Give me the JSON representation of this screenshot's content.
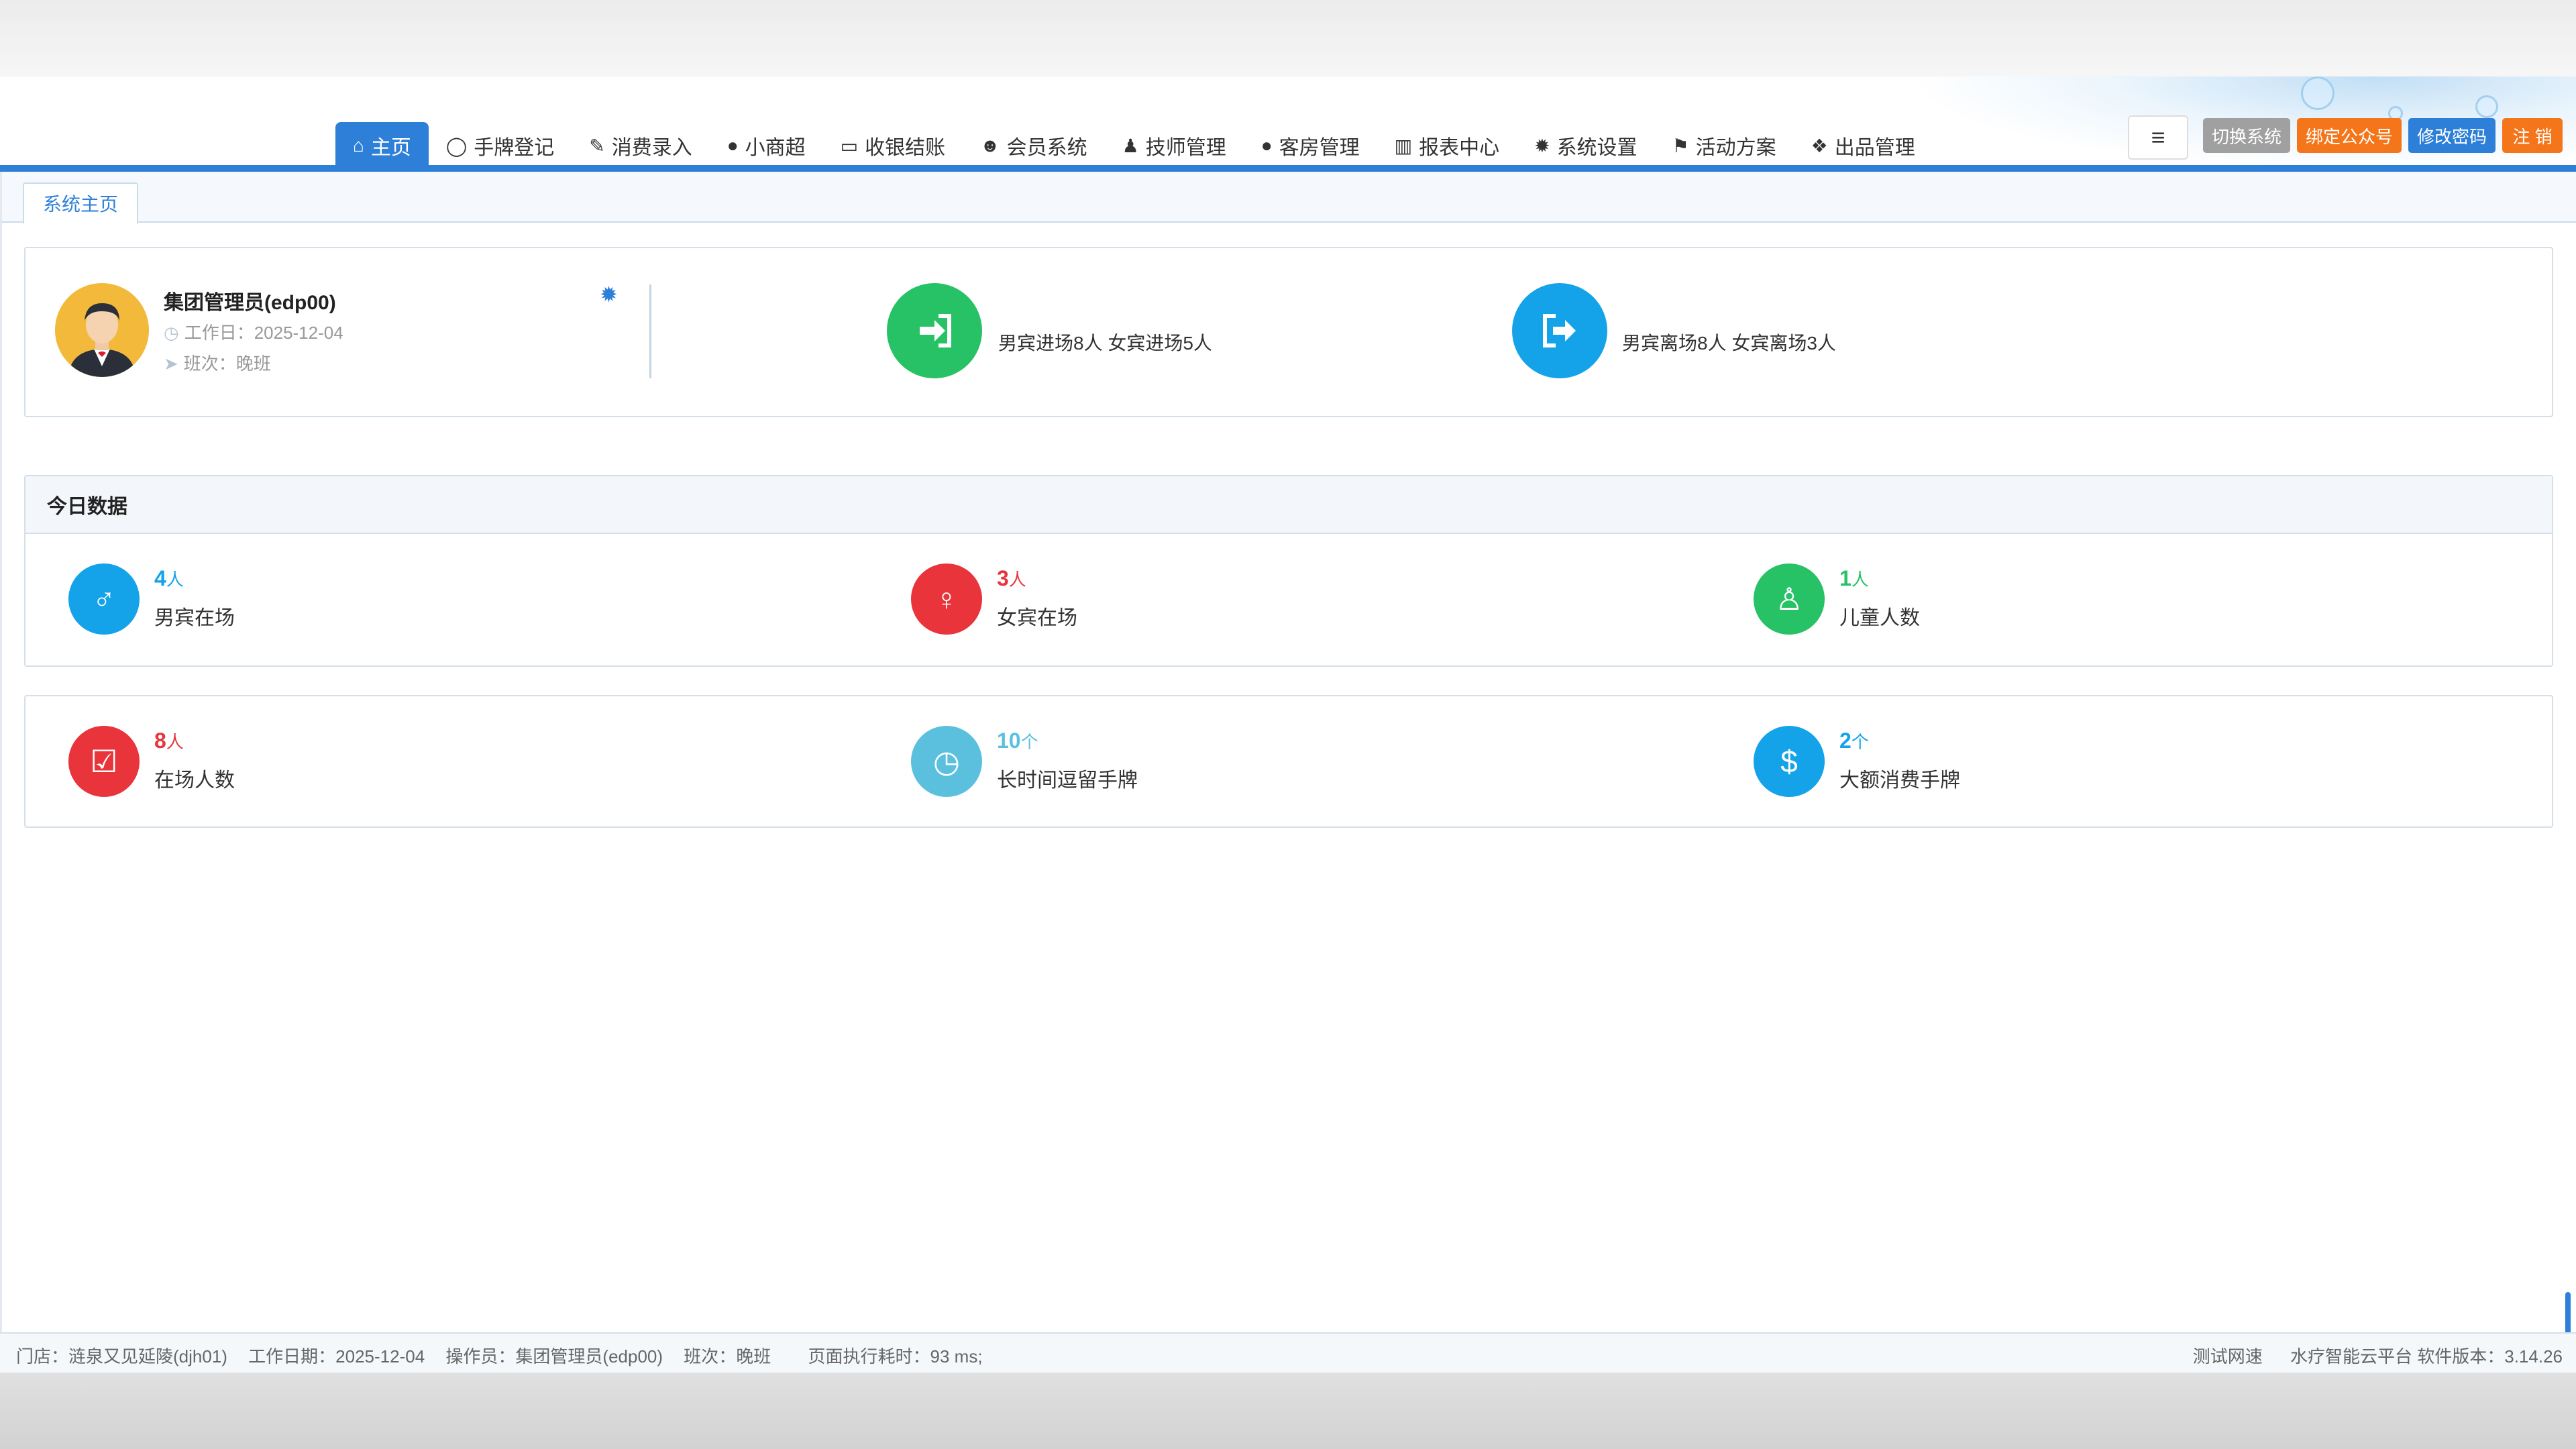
{
  "nav": {
    "items": [
      {
        "label": "主页",
        "icon": "home-icon",
        "glyph": "⌂",
        "active": true
      },
      {
        "label": "手牌登记",
        "icon": "refresh-icon",
        "glyph": "◯"
      },
      {
        "label": "消费录入",
        "icon": "edit-icon",
        "glyph": "✎"
      },
      {
        "label": "小商超",
        "icon": "user-icon",
        "glyph": "●"
      },
      {
        "label": "收银结账",
        "icon": "credit-card-icon",
        "glyph": "▭"
      },
      {
        "label": "会员系统",
        "icon": "users-icon",
        "glyph": "☻"
      },
      {
        "label": "技师管理",
        "icon": "person-icon",
        "glyph": "♟"
      },
      {
        "label": "客房管理",
        "icon": "user-icon",
        "glyph": "●"
      },
      {
        "label": "报表中心",
        "icon": "bar-chart-icon",
        "glyph": "▥"
      },
      {
        "label": "系统设置",
        "icon": "gear-icon",
        "glyph": "✹"
      },
      {
        "label": "活动方案",
        "icon": "flag-icon",
        "glyph": "⚑"
      },
      {
        "label": "出品管理",
        "icon": "cubes-icon",
        "glyph": "❖"
      }
    ],
    "menu_glyph": "≡"
  },
  "header_buttons": {
    "switch_system": "切换系统",
    "bind_wechat": "绑定公众号",
    "change_password": "修改密码",
    "logout": "注 销"
  },
  "tabs": {
    "home": "系统主页"
  },
  "user": {
    "name": "集团管理员(edp00)",
    "work_day": "工作日：2025-12-04",
    "shift": "班次：晚班"
  },
  "stats": {
    "entry_text": "男宾进场8人 女宾进场5人",
    "exit_text": "男宾离场8人 女宾离场3人"
  },
  "today": {
    "title": "今日数据",
    "items": [
      {
        "num": "4",
        "unit": "人",
        "label": "男宾在场",
        "color": "#14a3e8",
        "icon": "male-icon",
        "glyph": "♂"
      },
      {
        "num": "3",
        "unit": "人",
        "label": "女宾在场",
        "color": "#e8343a",
        "icon": "female-icon",
        "glyph": "♀"
      },
      {
        "num": "1",
        "unit": "人",
        "label": "儿童人数",
        "color": "#27c166",
        "icon": "child-icon",
        "glyph": "♙"
      }
    ]
  },
  "second": {
    "items": [
      {
        "num": "8",
        "unit": "人",
        "label": "在场人数",
        "color": "#e8343a",
        "icon": "check-square-icon",
        "glyph": "☑"
      },
      {
        "num": "10",
        "unit": "个",
        "label": "长时间逗留手牌",
        "color": "#5bc0de",
        "icon": "clock-icon",
        "glyph": "◷"
      },
      {
        "num": "2",
        "unit": "个",
        "label": "大额消费手牌",
        "color": "#14a3e8",
        "icon": "money-icon",
        "glyph": "$"
      }
    ]
  },
  "footer": {
    "store": "门店：涟泉又见延陵(djh01)",
    "work_date": "工作日期：2025-12-04",
    "operator": "操作员：集团管理员(edp00)",
    "shift": "班次：晚班",
    "exec_time": "页面执行耗时：93 ms;",
    "speed_test": "测试网速",
    "platform": "水疗智能云平台 软件版本：3.14.26"
  },
  "colors": {
    "primary": "#2d7fd8",
    "green": "#27c166",
    "blue": "#14a3e8",
    "red": "#e8343a",
    "orange": "#f5761a",
    "grey_button": "#a0a0a0"
  }
}
